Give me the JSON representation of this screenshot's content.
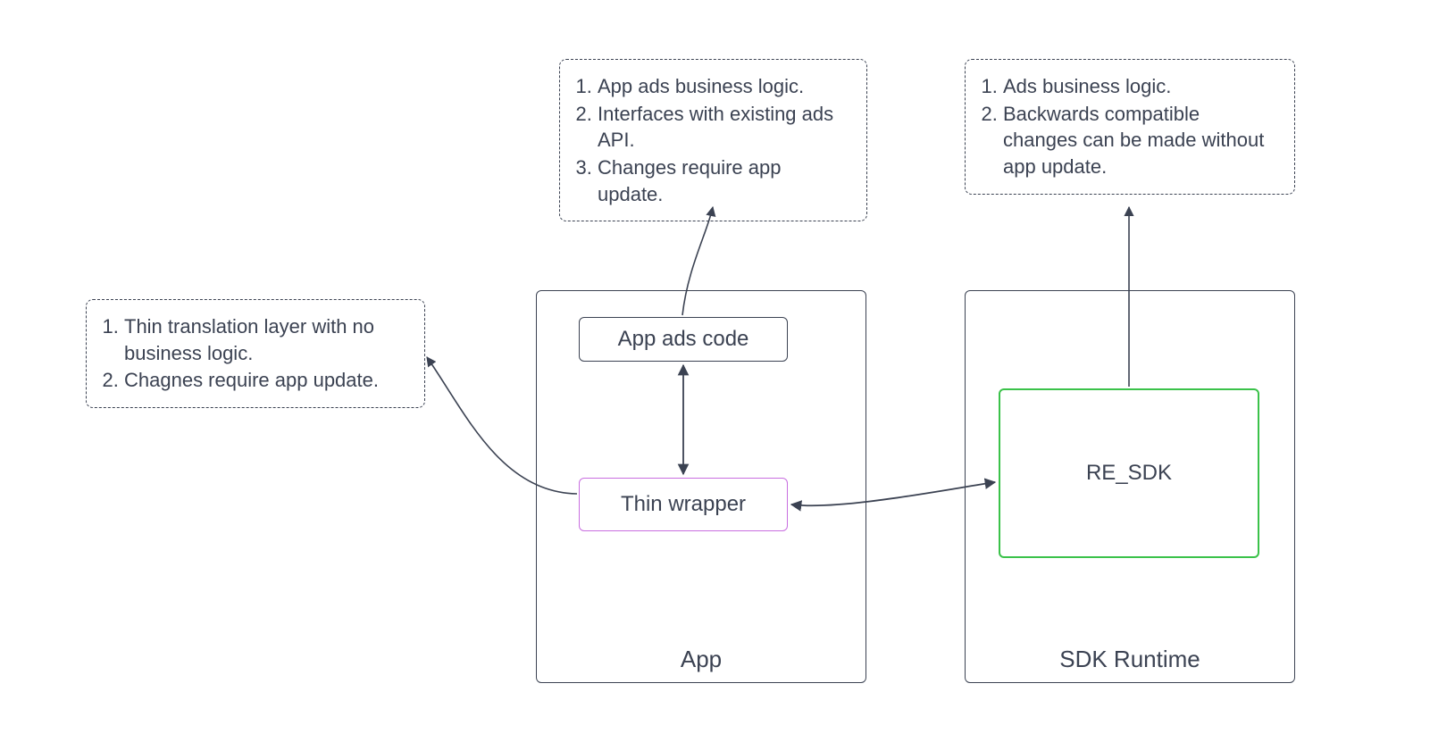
{
  "containers": {
    "app": {
      "label": "App"
    },
    "sdk": {
      "label": "SDK Runtime"
    }
  },
  "nodes": {
    "app_ads_code": {
      "label": "App ads code"
    },
    "thin_wrapper": {
      "label": "Thin wrapper"
    },
    "re_sdk": {
      "label": "RE_SDK"
    }
  },
  "notes": {
    "thin_wrapper": {
      "items": [
        "Thin translation layer with no business logic.",
        "Chagnes require app update."
      ]
    },
    "app_ads_code": {
      "items": [
        "App ads business logic.",
        "Interfaces with existing ads API.",
        "Changes require app update."
      ]
    },
    "re_sdk": {
      "items": [
        "Ads business logic.",
        "Backwards compatible changes can be made without app update."
      ]
    }
  }
}
